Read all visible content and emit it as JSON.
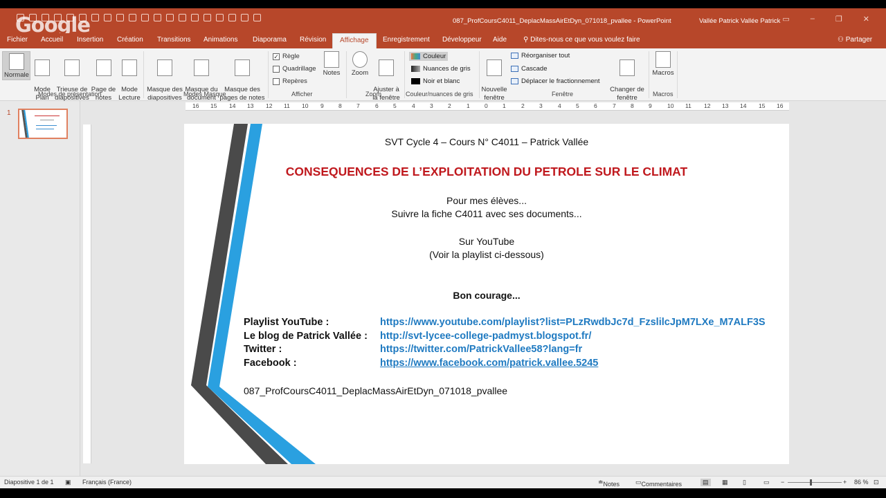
{
  "window": {
    "doc_title": "087_ProfCoursC4011_DeplacMassAirEtDyn_071018_pvallee  -  PowerPoint",
    "user": "Vallée Patrick Vallée Patrick",
    "watermark": "Google"
  },
  "tabs": [
    {
      "label": "Fichier"
    },
    {
      "label": "Accueil"
    },
    {
      "label": "Insertion"
    },
    {
      "label": "Création"
    },
    {
      "label": "Transitions"
    },
    {
      "label": "Animations"
    },
    {
      "label": "Diaporama"
    },
    {
      "label": "Révision"
    },
    {
      "label": "Affichage"
    },
    {
      "label": "Enregistrement"
    },
    {
      "label": "Développeur"
    },
    {
      "label": "Aide"
    }
  ],
  "tell_me": "Dites-nous ce que vous voulez faire",
  "share": "Partager",
  "ribbon": {
    "normal": "Normale",
    "plan": "Mode\nPlan",
    "trieuse": "Trieuse de\ndiapositives",
    "page_notes": "Page de\nnotes",
    "lecture": "Mode\nLecture",
    "group_modes": "Modes de présentation",
    "masque_diapo": "Masque des\ndiapositives",
    "masque_doc": "Masque du\ndocument",
    "masque_notes": "Masque des\npages de notes",
    "group_masque": "Modes Masque",
    "regle": "Règle",
    "quadrillage": "Quadrillage",
    "reperes": "Repères",
    "notes": "Notes",
    "group_afficher": "Afficher",
    "zoom": "Zoom",
    "ajuster": "Ajuster à\nla fenêtre",
    "group_zoom": "Zoom",
    "couleur": "Couleur",
    "gris": "Nuances de gris",
    "noir_blanc": "Noir et blanc",
    "group_couleur": "Couleur/nuances de gris",
    "nouvelle_fenetre": "Nouvelle\nfenêtre",
    "reorganiser": "Réorganiser tout",
    "cascade": "Cascade",
    "deplacer": "Déplacer le fractionnement",
    "group_fenetre": "Fenêtre",
    "changer": "Changer de\nfenêtre",
    "macros": "Macros",
    "group_macros": "Macros"
  },
  "thumbnail": {
    "number": "1"
  },
  "ruler": [
    "16",
    "15",
    "14",
    "13",
    "12",
    "11",
    "10",
    "9",
    "8",
    "7",
    "6",
    "5",
    "4",
    "3",
    "2",
    "1",
    "0",
    "1",
    "2",
    "3",
    "4",
    "5",
    "6",
    "7",
    "8",
    "9",
    "10",
    "11",
    "12",
    "13",
    "14",
    "15",
    "16"
  ],
  "slide": {
    "header": "SVT Cycle 4 – Cours N° C4011 – Patrick Vallée",
    "title": "CONSEQUENCES DE L’EXPLOITATION DU PETROLE SUR LE CLIMAT",
    "line1": "Pour mes élèves...",
    "line2": "Suivre la fiche C4011 avec ses documents...",
    "line3": "Sur YouTube",
    "line4": "(Voir la playlist ci-dessous)",
    "courage": "Bon courage...",
    "links": [
      {
        "label": "Playlist YouTube :",
        "url": "https://www.youtube.com/playlist?list=PLzRwdbJc7d_FzslilcJpM7LXe_M7ALF3S"
      },
      {
        "label": "Le blog de Patrick Vallée :",
        "url": "http://svt-lycee-college-padmyst.blogspot.fr/"
      },
      {
        "label": "Twitter :",
        "url": "https://twitter.com/PatrickVallee58?lang=fr"
      },
      {
        "label": "Facebook :",
        "url": "https://www.facebook.com/patrick.vallee.5245"
      }
    ],
    "filename": "087_ProfCoursC4011_DeplacMassAirEtDyn_071018_pvallee",
    "colors": {
      "title": "#c0191e",
      "link": "#1f7ac1",
      "bar_dark": "#4a4a4a",
      "bar_blue": "#2aa0e0"
    }
  },
  "status": {
    "slide_info": "Diapositive 1 de 1",
    "language": "Français (France)",
    "notes": "Notes",
    "comments": "Commentaires",
    "zoom": "86 %"
  }
}
